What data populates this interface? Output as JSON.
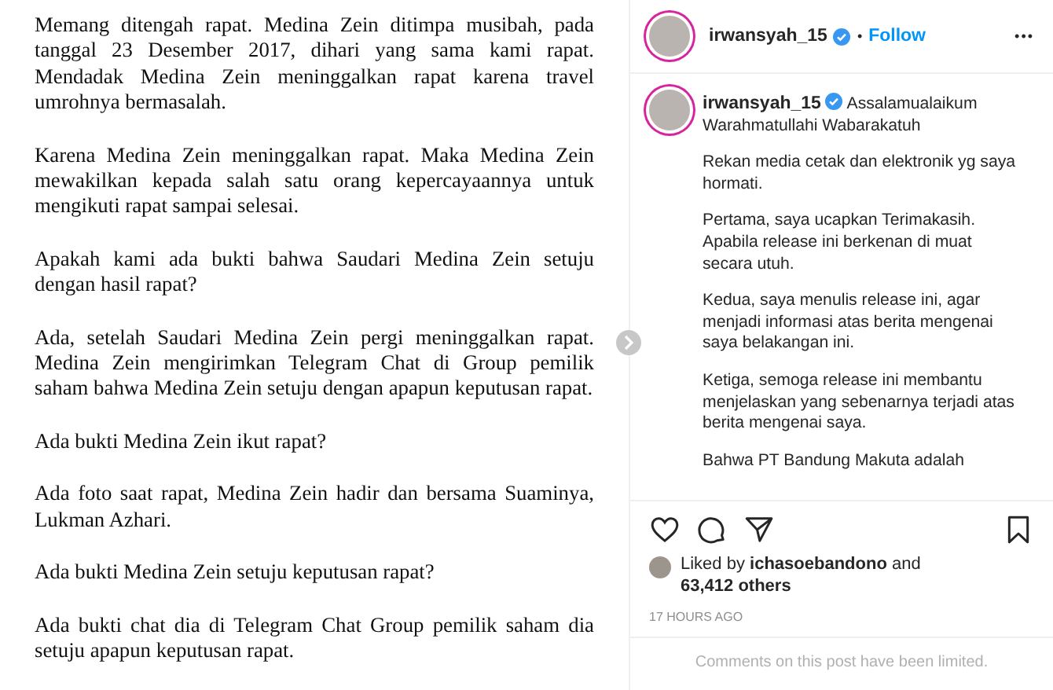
{
  "post_image": {
    "paragraphs": [
      "Memang ditengah rapat. Medina Zein ditimpa musibah, pada tanggal 23 Desember 2017, dihari yang sama kami rapat. Mendadak Medina Zein meninggalkan rapat karena travel umrohnya bermasalah.",
      "Karena Medina Zein meninggalkan rapat. Maka Medina Zein mewakilkan kepada salah satu orang kepercayaannya untuk mengikuti rapat sampai selesai.",
      "Apakah kami ada bukti bahwa Saudari Medina Zein setuju dengan hasil rapat?",
      "Ada, setelah Saudari Medina Zein pergi meninggalkan rapat. Medina Zein mengirimkan Telegram Chat di Group pemilik saham bahwa Medina Zein setuju dengan apapun keputusan rapat.",
      "Ada bukti Medina Zein ikut rapat?",
      "Ada foto saat rapat, Medina Zein hadir dan bersama Suaminya, Lukman Azhari.",
      "Ada bukti Medina Zein setuju keputusan rapat?",
      "Ada bukti chat dia di Telegram Chat Group pemilik saham dia setuju apapun keputusan rapat."
    ]
  },
  "header": {
    "username": "irwansyah_15",
    "verified": true,
    "separator": "•",
    "follow": "Follow",
    "more": "•••"
  },
  "caption": {
    "username": "irwansyah_15",
    "verified": true,
    "first_line": "Assalamualaikum Warahmatullahi Wabarakatuh",
    "paragraphs": [
      "Rekan media cetak dan elektronik yg saya hormati.",
      "Pertama, saya ucapkan Terimakasih. Apabila release ini berkenan di muat secara utuh.",
      "Kedua, saya menulis release ini, agar menjadi informasi atas berita mengenai saya belakangan ini.",
      "Ketiga, semoga release ini membantu menjelaskan yang sebenarnya terjadi atas berita mengenai saya.",
      "Bahwa PT Bandung Makuta adalah"
    ]
  },
  "likes": {
    "prefix": "Liked by",
    "user": "ichasoebandono",
    "suffix": "and",
    "count": "63,412 others"
  },
  "timestamp": "17 HOURS AGO",
  "comments_notice": "Comments on this post have been limited."
}
